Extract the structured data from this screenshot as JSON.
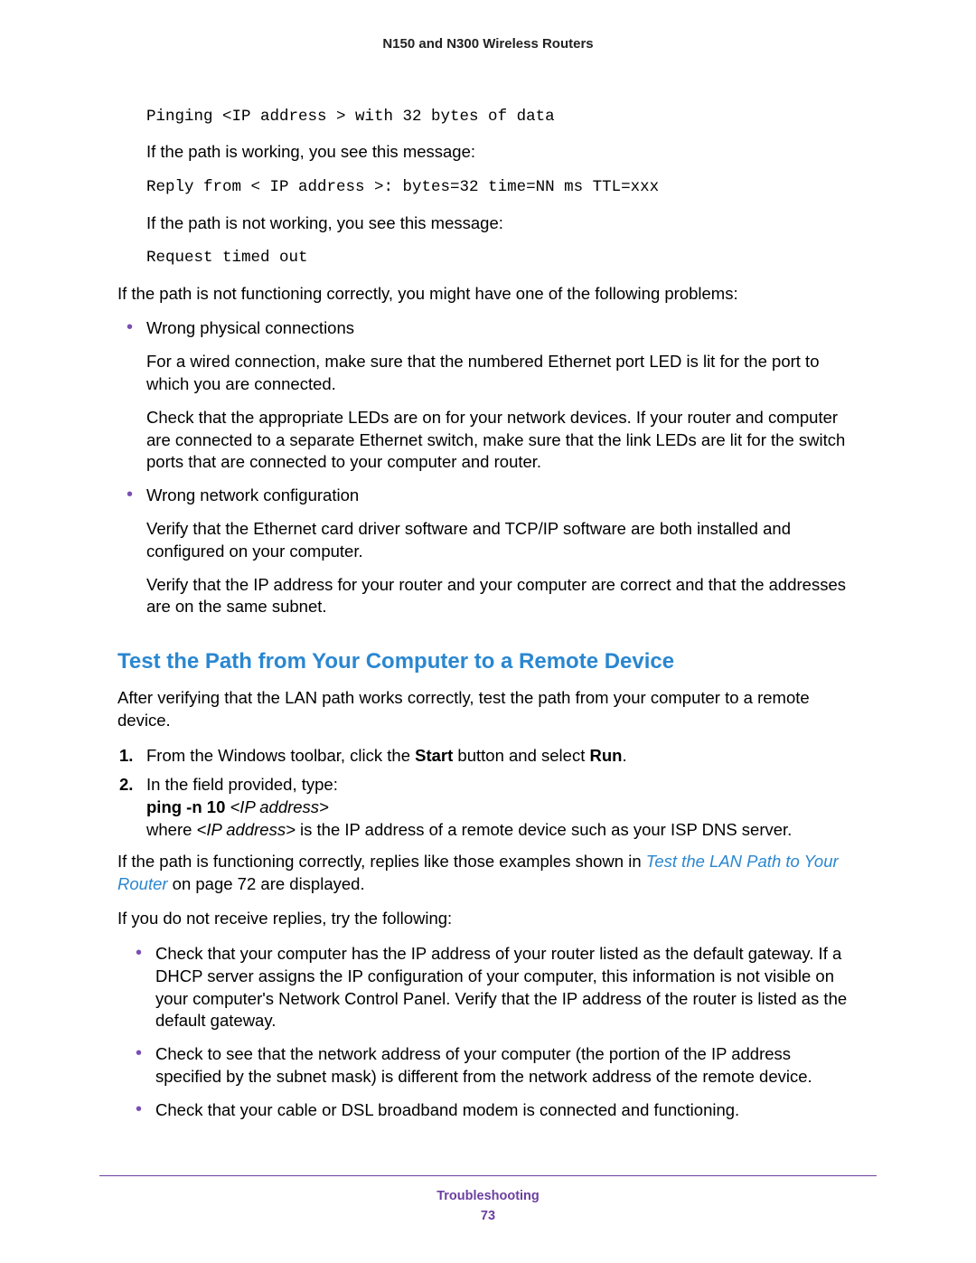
{
  "header": {
    "title": "N150 and N300 Wireless Routers"
  },
  "block_a": {
    "code1": "Pinging <IP address > with 32 bytes of data",
    "text1": "If the path is working, you see this message:",
    "code2": "Reply from < IP address >: bytes=32 time=NN ms TTL=xxx",
    "text2": "If the path is not working, you see this message:",
    "code3": "Request timed out"
  },
  "intro_problems": "If the path is not functioning correctly, you might have one of the following problems:",
  "bullets_a": [
    {
      "title": "Wrong physical connections",
      "paras": [
        "For a wired connection, make sure that the numbered Ethernet port LED is lit for the port to which you are connected.",
        "Check that the appropriate LEDs are on for your network devices. If your router and computer are connected to a separate Ethernet switch, make sure that the link LEDs are lit for the switch ports that are connected to your computer and router."
      ]
    },
    {
      "title": "Wrong network configuration",
      "paras": [
        "Verify that the Ethernet card driver software and TCP/IP software are both installed and configured on your computer.",
        "Verify that the IP address for your router and your computer are correct and that the addresses are on the same subnet."
      ]
    }
  ],
  "heading": "Test the Path from Your Computer to a Remote Device",
  "after_heading": "After verifying that the LAN path works correctly, test the path from your computer to a remote device.",
  "steps": {
    "s1_pre": "From the Windows toolbar, click the ",
    "s1_b1": "Start",
    "s1_mid": " button and select ",
    "s1_b2": "Run",
    "s1_post": ".",
    "s2_text": "In the field provided, type:",
    "s2_cmd_bold": "ping -n 10 ",
    "s2_cmd_italic": "<IP address>",
    "s2_where_pre": "where ",
    "s2_where_italic": "<IP address>",
    "s2_where_post": " is the IP address of a remote device such as your ISP DNS server."
  },
  "replies_para": {
    "pre": "If the path is functioning correctly, replies like those examples shown in ",
    "link": "Test the LAN Path to Your Router",
    "post": " on page 72 are displayed."
  },
  "no_reply_intro": "If you do not receive replies, try the following:",
  "bullets_b": [
    "Check that your computer has the IP address of your router listed as the default gateway. If a DHCP server assigns the IP configuration of your computer, this information is not visible on your computer's Network Control Panel. Verify that the IP address of the router is listed as the default gateway.",
    "Check to see that the network address of your computer (the portion of the IP address specified by the subnet mask) is different from the network address of the remote device.",
    "Check that your cable or DSL broadband modem is connected and functioning."
  ],
  "footer": {
    "section": "Troubleshooting",
    "page": "73"
  }
}
